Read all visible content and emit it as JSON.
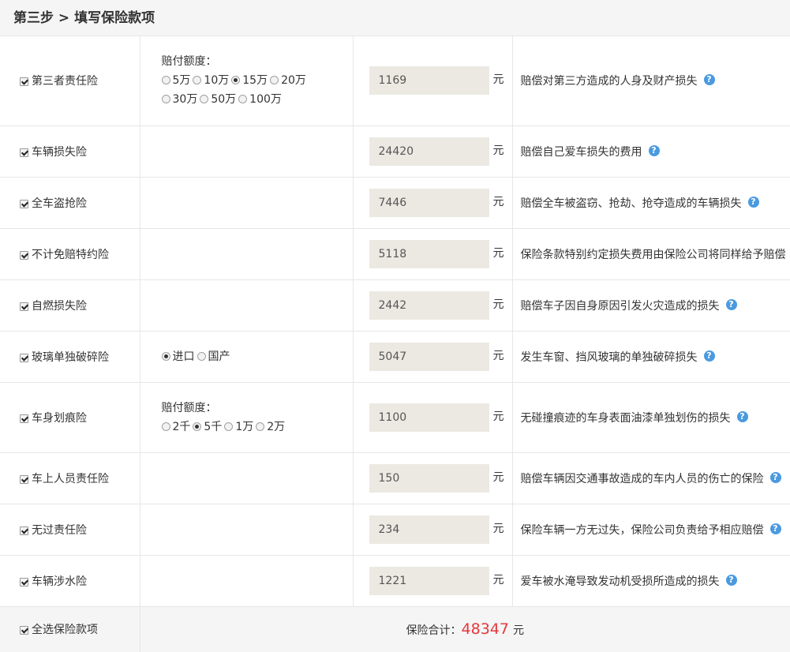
{
  "header": {
    "step": "第三步",
    "sep": ">",
    "title": "填写保险款项"
  },
  "rows": [
    {
      "name": "第三者责任险",
      "checked": true,
      "option_title": "赔付额度：",
      "option_lines": [
        [
          {
            "label": "5万",
            "selected": false
          },
          {
            "label": "10万",
            "selected": false
          },
          {
            "label": "15万",
            "selected": true
          },
          {
            "label": "20万",
            "selected": false
          }
        ],
        [
          {
            "label": "30万",
            "selected": false
          },
          {
            "label": "50万",
            "selected": false
          },
          {
            "label": "100万",
            "selected": false
          }
        ]
      ],
      "price": "1169",
      "unit": "元",
      "desc": "赔偿对第三方造成的人身及财产损失",
      "help": "?"
    },
    {
      "name": "车辆损失险",
      "checked": true,
      "price": "24420",
      "unit": "元",
      "desc": "赔偿自己爱车损失的费用",
      "help": "?"
    },
    {
      "name": "全车盗抢险",
      "checked": true,
      "price": "7446",
      "unit": "元",
      "desc": "赔偿全车被盗窃、抢劫、抢夺造成的车辆损失",
      "help": "?"
    },
    {
      "name": "不计免赔特约险",
      "checked": true,
      "price": "5118",
      "unit": "元",
      "desc": "保险条款特别约定损失费用由保险公司将同样给予赔偿",
      "help": ""
    },
    {
      "name": "自燃损失险",
      "checked": true,
      "price": "2442",
      "unit": "元",
      "desc": "赔偿车子因自身原因引发火灾造成的损失",
      "help": "?"
    },
    {
      "name": "玻璃单独破碎险",
      "checked": true,
      "option_lines": [
        [
          {
            "label": "进口",
            "selected": true
          },
          {
            "label": "国产",
            "selected": false
          }
        ]
      ],
      "price": "5047",
      "unit": "元",
      "desc": "发生车窗、挡风玻璃的单独破碎损失",
      "help": "?"
    },
    {
      "name": "车身划痕险",
      "checked": true,
      "option_title": "赔付额度：",
      "option_lines": [
        [
          {
            "label": "2千",
            "selected": false
          },
          {
            "label": "5千",
            "selected": true
          },
          {
            "label": "1万",
            "selected": false
          },
          {
            "label": "2万",
            "selected": false
          }
        ]
      ],
      "price": "1100",
      "unit": "元",
      "desc": "无碰撞痕迹的车身表面油漆单独划伤的损失",
      "help": "?"
    },
    {
      "name": "车上人员责任险",
      "checked": true,
      "price": "150",
      "unit": "元",
      "desc": "赔偿车辆因交通事故造成的车内人员的伤亡的保险",
      "help": "?"
    },
    {
      "name": "无过责任险",
      "checked": true,
      "price": "234",
      "unit": "元",
      "desc": "保险车辆一方无过失，保险公司负责给予相应赔偿",
      "help": "?"
    },
    {
      "name": "车辆涉水险",
      "checked": true,
      "price": "1221",
      "unit": "元",
      "desc": "爱车被水淹导致发动机受损所造成的损失",
      "help": "?"
    }
  ],
  "footer": {
    "select_all_label": "全选保险款项",
    "select_all_checked": true,
    "total_label": "保险合计：",
    "total_value": "48347",
    "total_unit": "元"
  },
  "colors": {
    "accent_total": "#e4393c",
    "help_icon": "#4a9ae0",
    "input_bg": "#ebe9e2",
    "header_bg": "#f5f5f5"
  }
}
